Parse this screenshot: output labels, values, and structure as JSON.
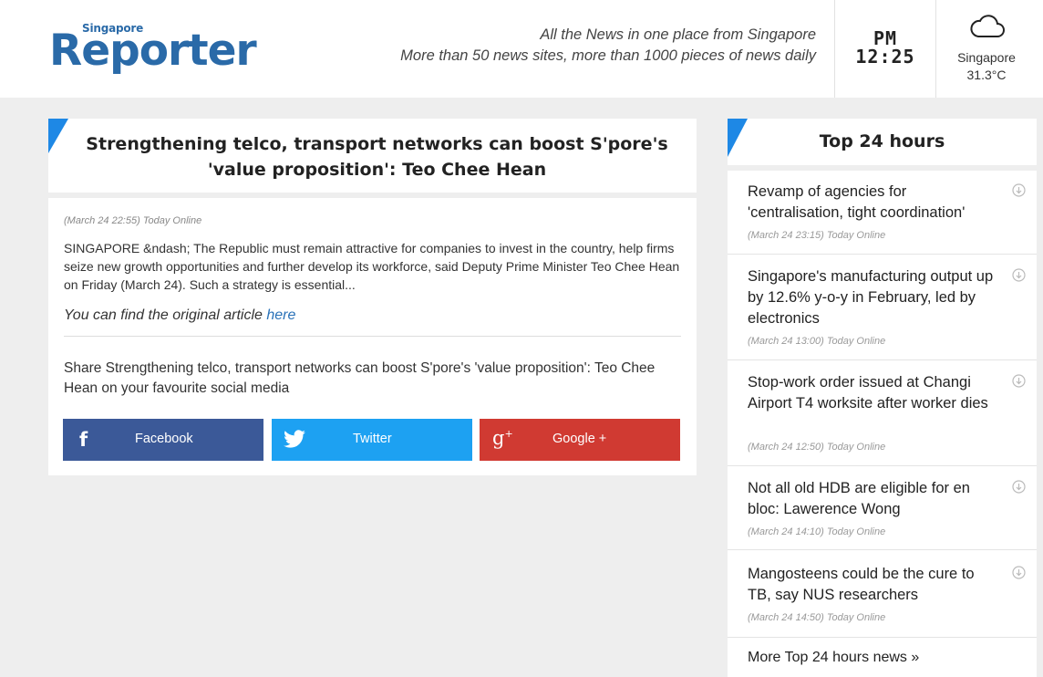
{
  "header": {
    "logo_small": "Singapore",
    "logo_big": "Reporter",
    "tagline_line1": "All the News in one place from Singapore",
    "tagline_line2": "More than 50 news sites, more than 1000 pieces of news daily",
    "clock_ampm": "PM",
    "clock_time": "12:25",
    "weather_icon": "cloud-icon",
    "weather_city": "Singapore",
    "weather_temp": "31.3°C"
  },
  "article": {
    "title_line1": "Strengthening telco, transport networks can boost S'pore's",
    "title_line2": "'value proposition': Teo Chee Hean",
    "meta": "(March 24 22:55) Today Online",
    "excerpt": "SINGAPORE &ndash; The Republic must remain attractive for companies to invest in the country, help firms seize new growth opportunities and further develop its workforce, said Deputy Prime Minister Teo Chee Hean on Friday (March 24). Such a strategy is essential...",
    "orig_prefix": "You can find the original article ",
    "orig_link": "here",
    "share_text": "Share Strengthening telco, transport networks can boost S'pore's 'value proposition': Teo Chee Hean on your favourite social media",
    "share_buttons": {
      "facebook": "Facebook",
      "twitter": "Twitter",
      "google": "Google +"
    }
  },
  "sidebar": {
    "title": "Top 24 hours",
    "items": [
      {
        "headline": "Revamp of agencies for 'centralisation, tight coordination'",
        "meta": "(March 24 23:15) Today Online"
      },
      {
        "headline": "Singapore's manufacturing output up by 12.6% y-o-y in February, led by electronics",
        "meta": "(March 24 13:00) Today Online"
      },
      {
        "headline": "Stop-work order issued at Changi Airport T4 worksite after worker dies",
        "meta": "(March 24 12:50) Today Online"
      },
      {
        "headline": "Not all old HDB are eligible for en bloc: Lawerence Wong",
        "meta": "(March 24 14:10) Today Online"
      },
      {
        "headline": "Mangosteens could be the cure to TB, say NUS researchers",
        "meta": "(March 24 14:50) Today Online"
      }
    ],
    "more_link": "More Top 24 hours news »"
  },
  "colors": {
    "accent": "#1e88e5",
    "logo": "#2a6aa8",
    "facebook": "#3b5998",
    "twitter": "#1da1f2",
    "google": "#d03a32"
  }
}
